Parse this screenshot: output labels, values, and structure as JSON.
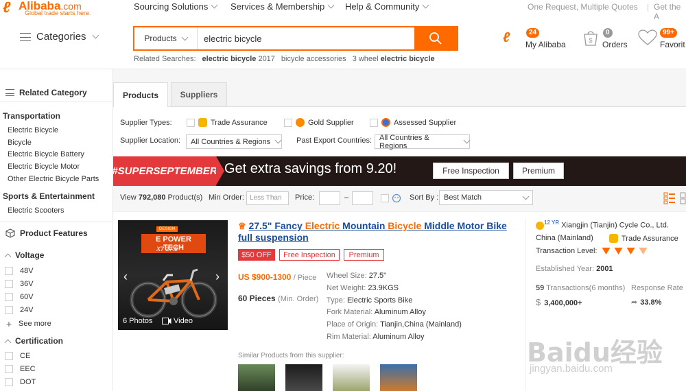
{
  "header": {
    "logo_text": "Alibaba",
    "logo_com": ".com",
    "logo_tagline": "Global trade starts here.",
    "top_nav": [
      {
        "label": "Sourcing Solutions"
      },
      {
        "label": "Services & Membership"
      },
      {
        "label": "Help & Community"
      }
    ],
    "top_right": [
      "One Request, Multiple Quotes",
      "|",
      "Get the A"
    ],
    "categories_label": "Categories",
    "search": {
      "category": "Products",
      "value": "electric bicycle"
    },
    "related_label": "Related Searches:",
    "related": [
      {
        "bold": "electric bicycle",
        "rest": " 2017"
      },
      {
        "bold": "",
        "rest": "bicycle accessories"
      },
      {
        "bold": "electric bicycle",
        "rest": "3 wheel "
      }
    ],
    "my_alibaba": {
      "label": "My Alibaba",
      "count": "24"
    },
    "orders": {
      "label": "Orders",
      "count": "0"
    },
    "favorites": {
      "label": "Favorit",
      "count": "99+"
    }
  },
  "sidebar": {
    "related_category": "Related Category",
    "groups": [
      {
        "title": "Transportation",
        "links": [
          "Electric Bicycle",
          "Bicycle",
          "Electric Bicycle Battery",
          "Electric Bicycle Motor",
          "Other Electric Bicycle Parts"
        ]
      },
      {
        "title": "Sports & Entertainment",
        "links": [
          "Electric Scooters"
        ]
      }
    ],
    "product_features": "Product Features",
    "voltage": {
      "title": "Voltage",
      "options": [
        "48V",
        "36V",
        "60V",
        "24V"
      ],
      "see_more": "See more"
    },
    "certification": {
      "title": "Certification",
      "options": [
        "CE",
        "EEC",
        "DOT"
      ]
    }
  },
  "tabs": [
    {
      "label": "Products",
      "active": true
    },
    {
      "label": "Suppliers",
      "active": false
    }
  ],
  "filters": {
    "supplier_types_label": "Supplier Types:",
    "supplier_types": [
      "Trade Assurance",
      "Gold Supplier",
      "Assessed Supplier"
    ],
    "supplier_location_label": "Supplier Location:",
    "supplier_location_value": "All Countries & Regions",
    "past_export_label": "Past Export Countries:",
    "past_export_value": "All Countries & Regions"
  },
  "banner": {
    "tag": "#SUPERSEPTEMBER",
    "text": "Get extra savings from 9.20!",
    "buttons": [
      "Free Inspection",
      "Premium"
    ]
  },
  "sortbar": {
    "view_prefix": "View",
    "count": "792,080",
    "view_suffix": "Product(s)",
    "min_order_label": "Min Order:",
    "min_order_placeholder": "Less Than",
    "price_label": "Price:",
    "price_dash": "–",
    "sort_label": "Sort By :",
    "sort_value": "Best Match"
  },
  "product": {
    "image": {
      "banner_small": "DESIGN",
      "banner_big": "E POWER TECH",
      "banner_model": "X7 27.5",
      "photos": "6 Photos",
      "video": "Video"
    },
    "title_parts": [
      {
        "t": "27.5\" Fancy ",
        "hl": false
      },
      {
        "t": "Electric",
        "hl": true
      },
      {
        "t": " Mountain ",
        "hl": false
      },
      {
        "t": "Bicycle",
        "hl": true
      },
      {
        "t": " Middle Motor Bike full suspension",
        "hl": false
      }
    ],
    "tags": [
      "$50 OFF",
      "Free Inspection",
      "Premium"
    ],
    "price": "US $900-1300",
    "price_unit": "/ Piece",
    "moq": "60 Pieces",
    "moq_note": "(Min. Order)",
    "attributes": [
      {
        "k": "Wheel Size:",
        "v": "27.5\""
      },
      {
        "k": "Net Weight:",
        "v": "23.9KGS"
      },
      {
        "k": "Type:",
        "v": "Electric Sports Bike"
      },
      {
        "k": "Fork Material:",
        "v": "Aluminum Alloy"
      },
      {
        "k": "Place of Origin:",
        "v": "Tianjin,China (Mainland)"
      },
      {
        "k": "Rim Material:",
        "v": "Aluminum Alloy"
      }
    ],
    "similar_label": "Similar Products from this supplier:"
  },
  "supplier": {
    "years": "12 YR",
    "name": "Xiangjin (Tianjin) Cycle Co., Ltd.",
    "country": "China (Mainland)",
    "trade_assurance": "Trade Assurance",
    "transaction_label": "Transaction Level:",
    "established_label": "Established Year:",
    "established": "2001",
    "transactions": "59",
    "transactions_label": "Transactions(6 months)",
    "volume": "3,400,000+",
    "response_label": "Response Rate",
    "response": "33.8%"
  },
  "watermark": {
    "brand": "Baidu",
    "cn": "经验",
    "url": "jingyan.baidu.com"
  },
  "colors": {
    "accent": "#ff6a00",
    "link": "#1a4d9c",
    "promo": "#e4393c"
  }
}
